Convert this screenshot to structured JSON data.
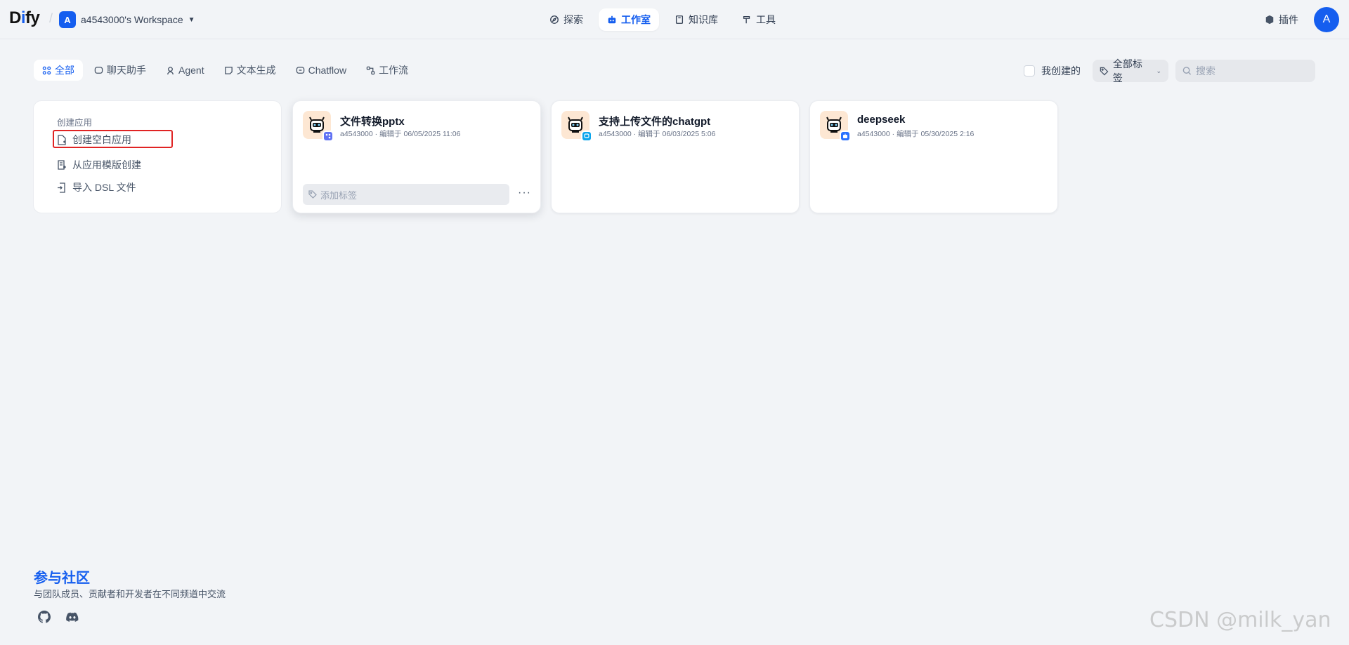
{
  "header": {
    "logo_text": "Dify",
    "workspace_initial": "A",
    "workspace_name": "a4543000's Workspace",
    "nav": [
      {
        "label": "探索",
        "icon": "compass-icon"
      },
      {
        "label": "工作室",
        "icon": "robot-icon",
        "active": true
      },
      {
        "label": "知识库",
        "icon": "book-icon"
      },
      {
        "label": "工具",
        "icon": "hammer-icon"
      }
    ],
    "plugins_label": "插件",
    "user_initial": "A"
  },
  "filters": {
    "tabs": [
      {
        "label": "全部",
        "active": true
      },
      {
        "label": "聊天助手"
      },
      {
        "label": "Agent"
      },
      {
        "label": "文本生成"
      },
      {
        "label": "Chatflow"
      },
      {
        "label": "工作流"
      }
    ],
    "mine_label": "我创建的",
    "tags_label": "全部标签",
    "search_placeholder": "搜索"
  },
  "create_card": {
    "title": "创建应用",
    "items": [
      {
        "label": "创建空白应用",
        "highlighted": true
      },
      {
        "label": "从应用模版创建"
      },
      {
        "label": "导入 DSL 文件"
      }
    ]
  },
  "apps": [
    {
      "name": "文件转换pptx",
      "author": "a4543000",
      "edited": "编辑于 06/05/2025 11:06",
      "badge_color": "#6172f3",
      "add_tag_label": "添加标签",
      "more": "···"
    },
    {
      "name": "支持上传文件的chatgpt",
      "author": "a4543000",
      "edited": "编辑于 06/03/2025 5:06",
      "badge_color": "#0ba5ec"
    },
    {
      "name": "deepseek",
      "author": "a4543000",
      "edited": "编辑于 05/30/2025 2:16",
      "badge_color": "#2970ff"
    }
  ],
  "community": {
    "title": "参与社区",
    "description": "与团队成员、贡献者和开发者在不同频道中交流",
    "links": [
      "github-icon",
      "discord-icon"
    ]
  },
  "watermark": "CSDN @milk_yan",
  "colors": {
    "accent": "#155eef",
    "background": "#f2f4f7",
    "highlight": "#e02424"
  }
}
